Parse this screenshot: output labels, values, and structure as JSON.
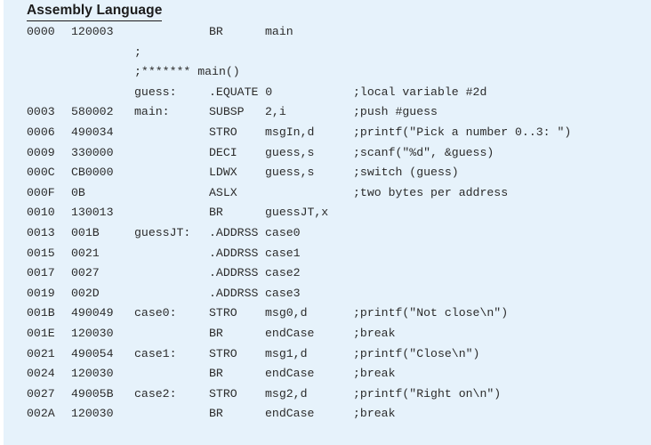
{
  "panel": {
    "title": "Assembly Language",
    "background_color": "#e6f2fb",
    "text_color": "#2b2b2b"
  },
  "columns": [
    "addr",
    "obj",
    "sym",
    "mnem",
    "oprnd",
    "cmt"
  ],
  "lines": [
    {
      "addr": "0000",
      "obj": "120003",
      "sym": "",
      "mnem": "BR",
      "oprnd": "main",
      "cmt": ""
    },
    {
      "addr": "",
      "obj": "",
      "sym": ";",
      "mnem": "",
      "oprnd": "",
      "cmt": ""
    },
    {
      "addr": "",
      "obj": "",
      "sym": ";******* main()",
      "mnem": "",
      "oprnd": "",
      "cmt": ""
    },
    {
      "addr": "",
      "obj": "",
      "sym": "guess:",
      "mnem": ".EQUATE 0",
      "oprnd": "",
      "cmt": ";local variable #2d"
    },
    {
      "addr": "0003",
      "obj": "580002",
      "sym": "main:",
      "mnem": "SUBSP",
      "oprnd": "2,i",
      "cmt": ";push #guess"
    },
    {
      "addr": "0006",
      "obj": "490034",
      "sym": "",
      "mnem": "STRO",
      "oprnd": "msgIn,d",
      "cmt": ";printf(\"Pick a number 0..3: \")"
    },
    {
      "addr": "0009",
      "obj": "330000",
      "sym": "",
      "mnem": "DECI",
      "oprnd": "guess,s",
      "cmt": ";scanf(\"%d\", &guess)"
    },
    {
      "addr": "000C",
      "obj": "CB0000",
      "sym": "",
      "mnem": "LDWX",
      "oprnd": "guess,s",
      "cmt": ";switch (guess)"
    },
    {
      "addr": "000F",
      "obj": "0B",
      "sym": "",
      "mnem": "ASLX",
      "oprnd": "",
      "cmt": ";two bytes per address"
    },
    {
      "addr": "0010",
      "obj": "130013",
      "sym": "",
      "mnem": "BR",
      "oprnd": "guessJT,x",
      "cmt": ""
    },
    {
      "addr": "0013",
      "obj": "001B",
      "sym": "guessJT:",
      "mnem": ".ADDRSS",
      "oprnd": "case0",
      "cmt": ""
    },
    {
      "addr": "0015",
      "obj": "0021",
      "sym": "",
      "mnem": ".ADDRSS",
      "oprnd": "case1",
      "cmt": ""
    },
    {
      "addr": "0017",
      "obj": "0027",
      "sym": "",
      "mnem": ".ADDRSS",
      "oprnd": "case2",
      "cmt": ""
    },
    {
      "addr": "0019",
      "obj": "002D",
      "sym": "",
      "mnem": ".ADDRSS",
      "oprnd": "case3",
      "cmt": ""
    },
    {
      "addr": "001B",
      "obj": "490049",
      "sym": "case0:",
      "mnem": "STRO",
      "oprnd": "msg0,d",
      "cmt": ";printf(\"Not close\\n\")"
    },
    {
      "addr": "001E",
      "obj": "120030",
      "sym": "",
      "mnem": "BR",
      "oprnd": "endCase",
      "cmt": ";break"
    },
    {
      "addr": "0021",
      "obj": "490054",
      "sym": "case1:",
      "mnem": "STRO",
      "oprnd": "msg1,d",
      "cmt": ";printf(\"Close\\n\")"
    },
    {
      "addr": "0024",
      "obj": "120030",
      "sym": "",
      "mnem": "BR",
      "oprnd": "endCase",
      "cmt": ";break"
    },
    {
      "addr": "0027",
      "obj": "49005B",
      "sym": "case2:",
      "mnem": "STRO",
      "oprnd": "msg2,d",
      "cmt": ";printf(\"Right on\\n\")"
    },
    {
      "addr": "002A",
      "obj": "120030",
      "sym": "",
      "mnem": "BR",
      "oprnd": "endCase",
      "cmt": ";break"
    }
  ]
}
